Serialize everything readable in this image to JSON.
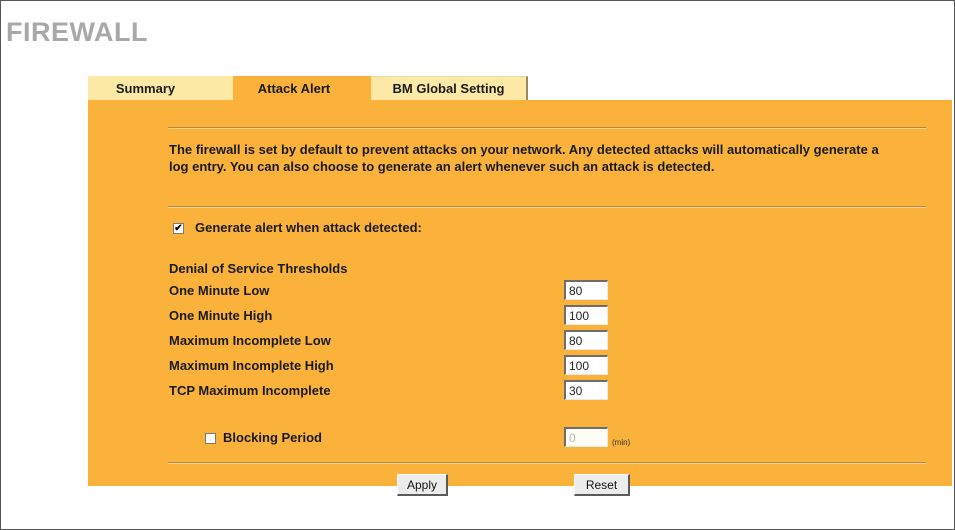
{
  "page": {
    "title": "FIREWALL"
  },
  "tabs": [
    {
      "label": "Summary",
      "active": false
    },
    {
      "label": "Attack Alert",
      "active": true
    },
    {
      "label": "BM Global Setting",
      "active": false
    }
  ],
  "intro_text": "The firewall is set by default to prevent attacks on your network. Any detected attacks will automatically generate a log entry. You can also choose to generate an alert whenever such an attack is detected.",
  "generate_alert": {
    "label": "Generate alert when attack detected:",
    "checked": true,
    "check_glyph": "✔"
  },
  "dos": {
    "heading": "Denial of Service Thresholds",
    "rows": [
      {
        "label": "One Minute Low",
        "value": "80"
      },
      {
        "label": "One Minute High",
        "value": "100"
      },
      {
        "label": "Maximum Incomplete Low",
        "value": "80"
      },
      {
        "label": "Maximum Incomplete High",
        "value": "100"
      },
      {
        "label": "TCP Maximum Incomplete",
        "value": "30"
      }
    ],
    "blocking": {
      "label": "Blocking Period",
      "checked": false,
      "value": "0",
      "unit": "(min)"
    }
  },
  "buttons": {
    "apply": "Apply",
    "reset": "Reset"
  },
  "colors": {
    "panel": "#fbb23a",
    "tab_inactive": "#fde9a6",
    "title": "#a8a8a8"
  }
}
